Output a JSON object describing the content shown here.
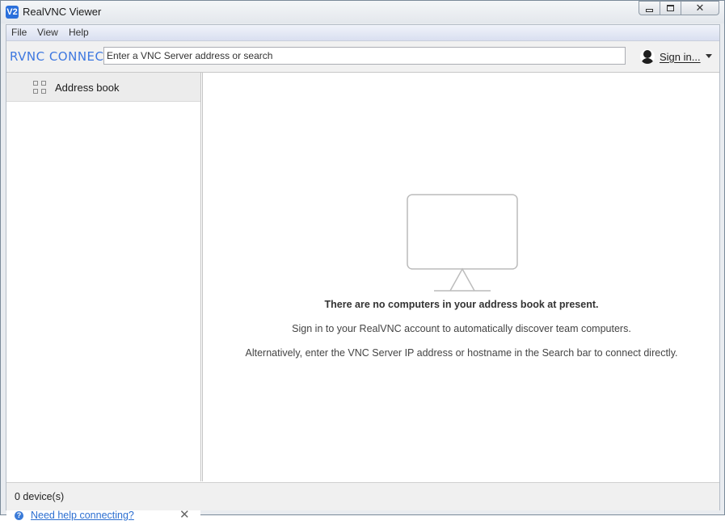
{
  "window": {
    "title": "RealVNC Viewer",
    "app_icon": "vnc-icon",
    "app_icon_glyph": "V2",
    "controls": {
      "minimize": "minimize-icon",
      "maximize": "maximize-icon",
      "close": "✕"
    }
  },
  "menubar": {
    "items": [
      {
        "label": "File"
      },
      {
        "label": "View"
      },
      {
        "label": "Help"
      }
    ]
  },
  "toolbar": {
    "brand": "RVNC CONNECT",
    "search_placeholder": "Enter a VNC Server address or search",
    "search_value": "",
    "signin_label": "Sign in...",
    "signin_icon": "user-icon",
    "dropdown_icon": "chevron-down-icon"
  },
  "sidebar": {
    "items": [
      {
        "label": "Address book",
        "icon": "grid-icon"
      }
    ],
    "help": {
      "icon": "question-icon",
      "icon_glyph": "?",
      "link": "Need help connecting?",
      "close_glyph": "✕"
    }
  },
  "main": {
    "empty_icon": "monitor-icon",
    "empty_title": "There are no computers in your address book at present.",
    "lines": [
      "Sign in to your RealVNC account to automatically discover team computers.",
      "Alternatively, enter the VNC Server IP address or hostname in the Search bar to connect directly."
    ]
  },
  "status": {
    "text": "0 device(s)"
  },
  "colors": {
    "brand": "#3e78e0",
    "link": "#2c6fd1",
    "accent": "#3b7bd8"
  }
}
